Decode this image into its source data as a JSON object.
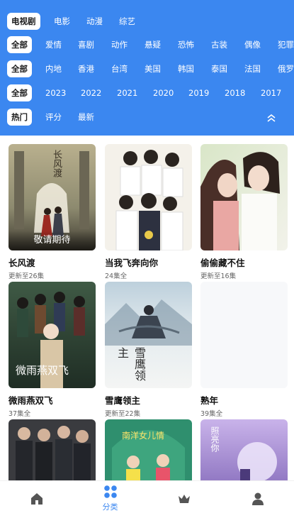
{
  "colors": {
    "accent": "#3b87f0",
    "tab_inactive": "#555555"
  },
  "filters": {
    "type_row": [
      "电视剧",
      "电影",
      "动漫",
      "综艺"
    ],
    "genre_row": [
      "全部",
      "爱情",
      "喜剧",
      "动作",
      "悬疑",
      "恐怖",
      "古装",
      "偶像",
      "犯罪"
    ],
    "region_row": [
      "全部",
      "内地",
      "香港",
      "台湾",
      "美国",
      "韩国",
      "泰国",
      "法国",
      "俄罗斯"
    ],
    "year_row": [
      "全部",
      "2023",
      "2022",
      "2021",
      "2020",
      "2019",
      "2018",
      "2017"
    ],
    "sort_row": [
      "热门",
      "评分",
      "最新"
    ],
    "collapse_icon": "double-chevron-up-icon"
  },
  "grid": {
    "items": [
      {
        "title": "长风渡",
        "status": "更新至26集",
        "badge": "敬请期待",
        "poster_text": "长风渡"
      },
      {
        "title": "当我飞奔向你",
        "status": "24集全",
        "poster_text": ""
      },
      {
        "title": "偷偷藏不住",
        "status": "更新至16集",
        "poster_text": ""
      },
      {
        "title": "微雨燕双飞",
        "status": "37集全",
        "poster_text": "微雨燕双飞"
      },
      {
        "title": "雪鹰领主",
        "status": "更新至22集",
        "poster_text": "雪鹰领主"
      },
      {
        "title": "熟年",
        "status": "39集全",
        "poster_text": ""
      },
      {
        "title": "",
        "status": "",
        "poster_text": ""
      },
      {
        "title": "",
        "status": "",
        "poster_text": "南洋女儿情"
      },
      {
        "title": "",
        "status": "",
        "poster_text": "照亮你"
      }
    ]
  },
  "tabbar": {
    "tabs": [
      {
        "label": "",
        "icon": "home-icon"
      },
      {
        "label": "分类",
        "icon": "category-grid-icon"
      },
      {
        "label": "",
        "icon": "crown-icon"
      },
      {
        "label": "",
        "icon": "user-icon"
      }
    ]
  }
}
